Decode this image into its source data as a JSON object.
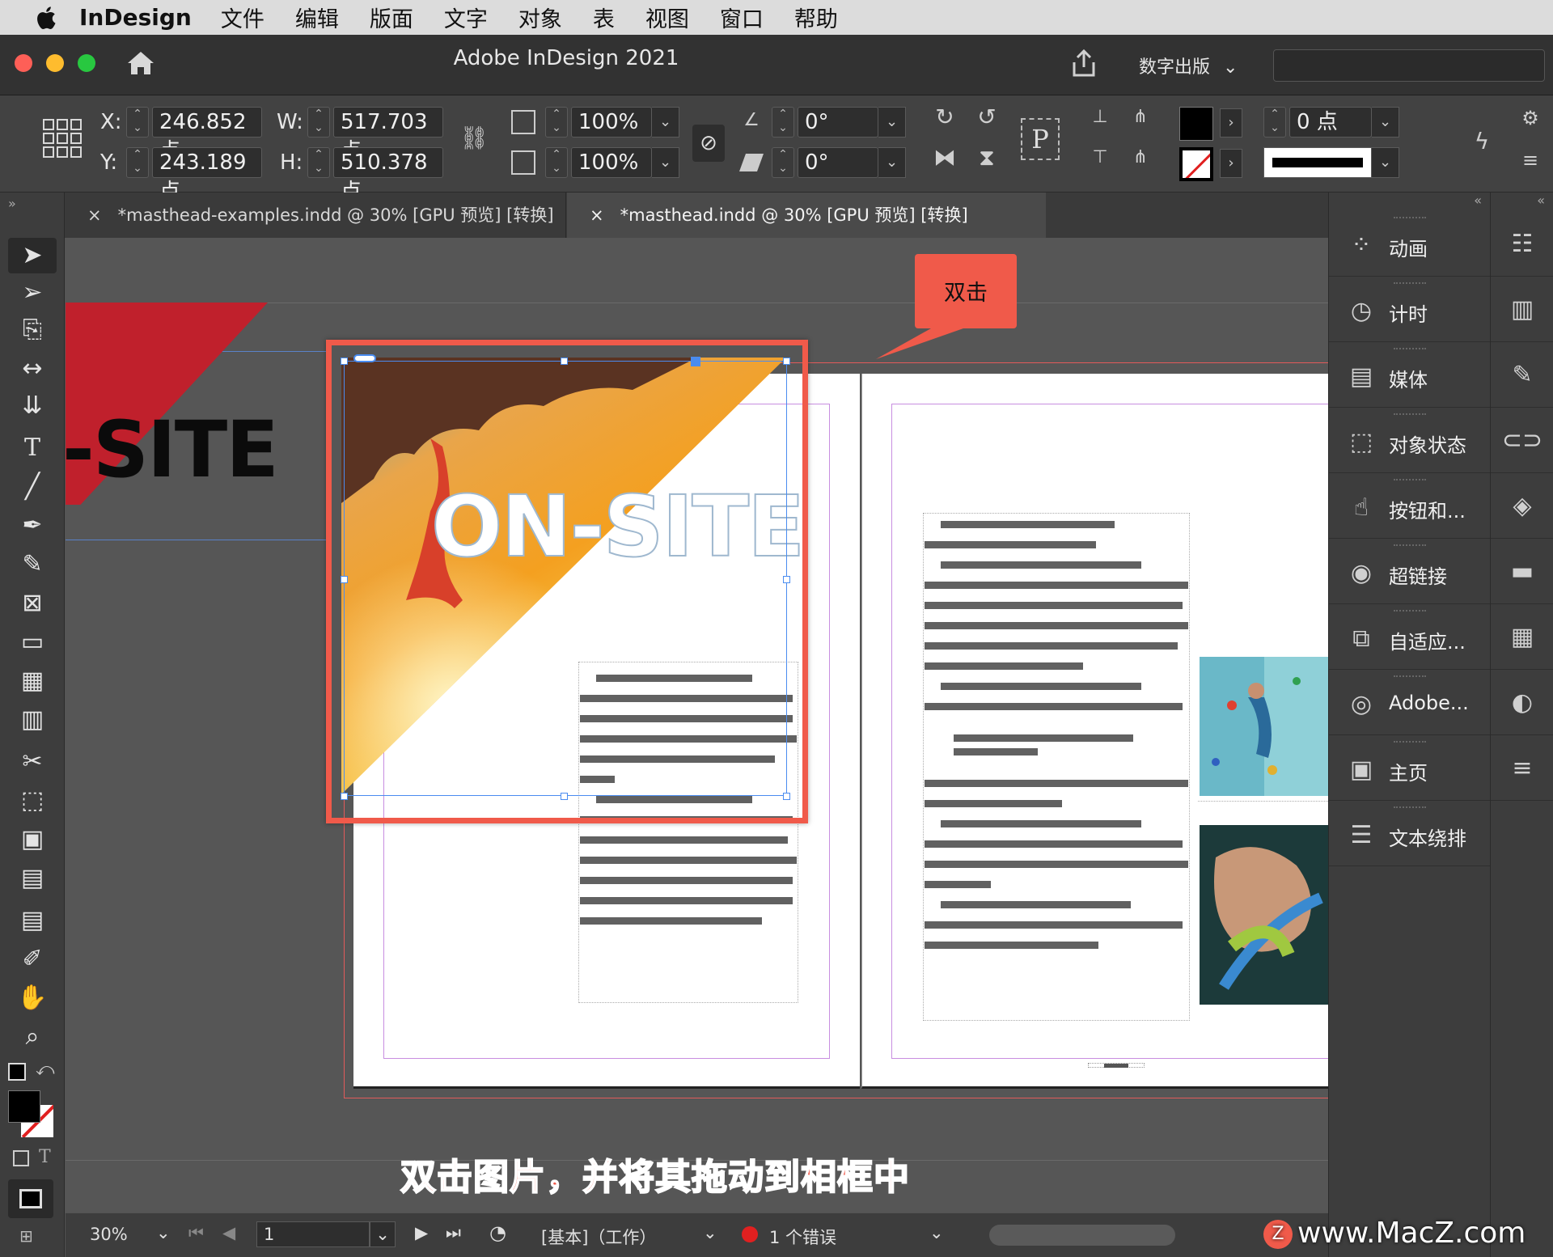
{
  "menubar": {
    "app_name": "InDesign",
    "items": [
      "文件",
      "编辑",
      "版面",
      "文字",
      "对象",
      "表",
      "视图",
      "窗口",
      "帮助"
    ]
  },
  "titlebar": {
    "title": "Adobe InDesign 2021",
    "workspace": "数字出版"
  },
  "control": {
    "x_label": "X:",
    "x_value": "246.852 点",
    "y_label": "Y:",
    "y_value": "243.189 点",
    "w_label": "W:",
    "w_value": "517.703 点",
    "h_label": "H:",
    "h_value": "510.378 点",
    "scale_x": "100%",
    "scale_y": "100%",
    "rotate": "0°",
    "shear": "0°",
    "stroke_weight": "0 点"
  },
  "tabs": [
    {
      "label": "*masthead-examples.indd @ 30% [GPU 预览] [转换]"
    },
    {
      "label": "*masthead.indd @ 30% [GPU 预览] [转换]"
    }
  ],
  "canvas": {
    "pasteboard_text": "-SITE",
    "headline": "ON-SITE",
    "callout": "双击"
  },
  "caption": "双击图片，并将其拖动到相框中",
  "panels": [
    {
      "label": "动画",
      "icon": "animation-icon"
    },
    {
      "label": "计时",
      "icon": "timing-icon"
    },
    {
      "label": "媒体",
      "icon": "media-icon"
    },
    {
      "label": "对象状态",
      "icon": "object-states-icon"
    },
    {
      "label": "按钮和...",
      "icon": "buttons-icon"
    },
    {
      "label": "超链接",
      "icon": "hyperlinks-icon"
    },
    {
      "label": "自适应...",
      "icon": "liquid-layout-icon"
    },
    {
      "label": "Adobe...",
      "icon": "adobe-fonts-icon"
    },
    {
      "label": "主页",
      "icon": "pages-icon"
    },
    {
      "label": "文本绕排",
      "icon": "text-wrap-icon"
    }
  ],
  "status": {
    "zoom": "30%",
    "page": "1",
    "style": "[基本]（工作）",
    "errors": "1 个错误"
  },
  "watermark": "www.MacZ.com",
  "colors": {
    "accent": "#f05a4a",
    "selection": "#4a8cf0",
    "masthead_red": "#c0202c"
  }
}
